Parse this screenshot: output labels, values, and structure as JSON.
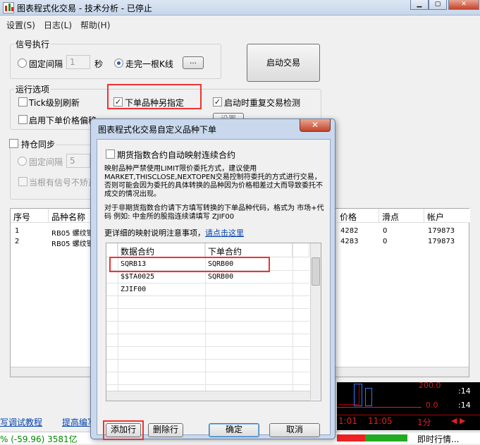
{
  "window": {
    "title": "图表程式化交易 - 技术分析 - 已停止"
  },
  "menu": {
    "items": [
      "设置(S)",
      "日志(L)",
      "帮助(H)"
    ]
  },
  "signal": {
    "group_label": "信号执行",
    "fixed_interval_label": "固定间隔",
    "interval_value": "1",
    "seconds_label": "秒",
    "kline_label": "走完一根K线",
    "ellipsis": "...",
    "start_button": "启动交易"
  },
  "run_options": {
    "group_label": "运行选项",
    "tick_refresh": "Tick级别刷新",
    "specify_contract": "下单品种另指定",
    "restart_detect": "启动时重复交易检测",
    "price_offset": "启用下单价格偏移",
    "settings_button": "设置"
  },
  "position_sync": {
    "group_label": "持仓同步",
    "fixed_interval_label": "固定间隔",
    "interval_value": "5",
    "only_signal": "当根有信号不矫正"
  },
  "listview": {
    "columns": [
      "序号",
      "品种名称",
      "价格",
      "滑点",
      "帐户"
    ],
    "rows": [
      {
        "no": "1",
        "name": "RB05 螺纹钢",
        "price": "4282",
        "slip": "0",
        "account": "179873"
      },
      {
        "no": "2",
        "name": "RB05 螺纹钢",
        "price": "4283",
        "slip": "0",
        "account": "179873"
      }
    ]
  },
  "bottom": {
    "links": [
      "写调试教程",
      "提高编写"
    ],
    "chart_values": [
      "200.0",
      "0.0"
    ],
    "times": [
      ":14",
      ":14"
    ],
    "period_labels": [
      "1:01",
      "11:05",
      "1分"
    ],
    "ticker_text": "% (-59.96) 3581亿",
    "ticker_right": "即时行情..."
  },
  "dialog": {
    "title": "图表程式化交易自定义品种下单",
    "close_glyph": "✕",
    "auto_map_label": "期货指数合约自动映射连续合约",
    "note1": "映射品种严禁使用LIMIT限价委托方式，建议使用MARKET,THISCLOSE,NEXTOPEN交易控制符委托的方式进行交易，否则可能会因为委托的具体转换的品种因为价格相差过大而导致委托不成交的情况出现。",
    "note2": "对于非期货指数合约请下方填写转换的下单品种代码，格式为 市场+代码 例如: 中金所的股指连续请填写 ZJIF00",
    "more_info_prefix": "更详细的映射说明注意事项，",
    "more_info_link": "请点击这里",
    "grid_columns": [
      "数据合约",
      "下单合约"
    ],
    "grid_rows": [
      {
        "data": "SQRB13",
        "order": "SQRB00"
      },
      {
        "data": "$$TA0025",
        "order": "SQRB00"
      },
      {
        "data": "ZJIF00",
        "order": ""
      }
    ],
    "add_row": "添加行",
    "delete_row": "删除行",
    "ok": "确定",
    "cancel": "取消"
  },
  "colors": {
    "highlight_red": "#e33333",
    "link_blue": "#0645ad"
  }
}
